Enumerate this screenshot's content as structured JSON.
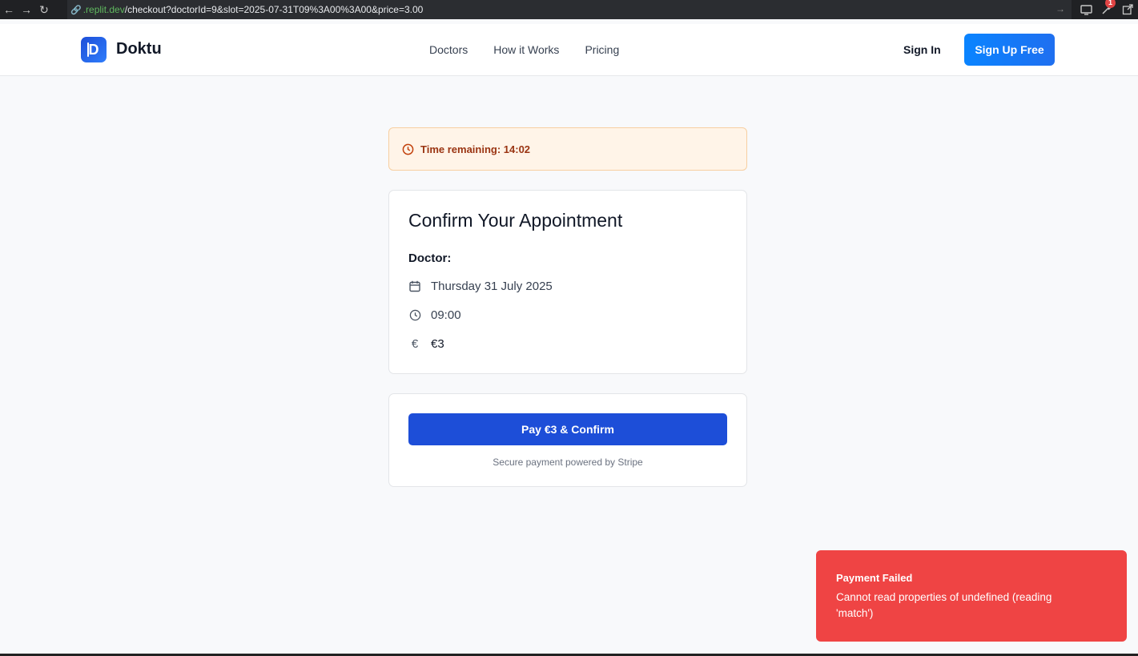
{
  "browser": {
    "url_host": ".replit.dev",
    "url_path": "/checkout?doctorId=9&slot=2025-07-31T09%3A00%3A00&price=3.00",
    "ext_badge": "1"
  },
  "nav": {
    "brand": "Doktu",
    "logo_letter": "D",
    "links": [
      "Doctors",
      "How it Works",
      "Pricing"
    ],
    "sign_in": "Sign In",
    "sign_up": "Sign Up Free"
  },
  "timer": {
    "label": "Time remaining: 14:02"
  },
  "appointment": {
    "title": "Confirm Your Appointment",
    "doctor_label": "Doctor:",
    "date": "Thursday 31 July 2025",
    "time": "09:00",
    "price": "€3"
  },
  "payment": {
    "button_label": "Pay €3 & Confirm",
    "secure_note": "Secure payment powered by Stripe"
  },
  "toast": {
    "title": "Payment Failed",
    "message": "Cannot read properties of undefined (reading 'match')"
  },
  "colors": {
    "primary": "#1d4ed8",
    "toast_error": "#ef4444",
    "timer_bg": "#fff4e8"
  }
}
